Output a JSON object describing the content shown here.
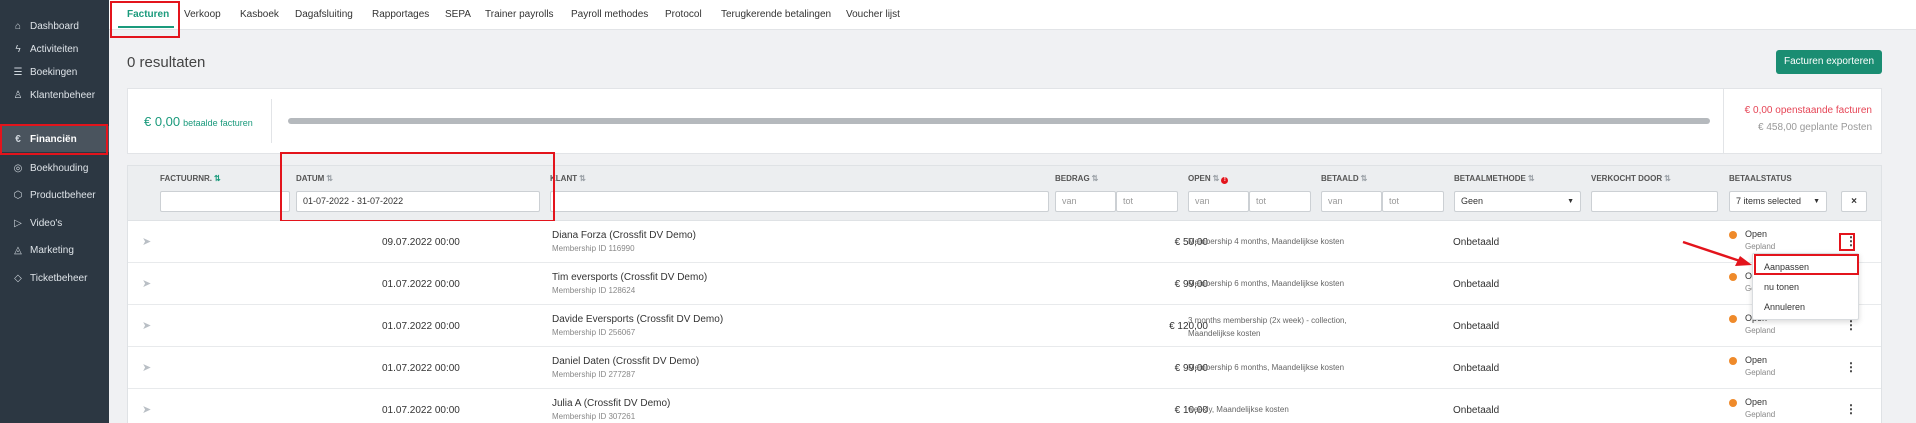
{
  "sidebar": {
    "items": [
      {
        "label": "Dashboard",
        "icon": "home-icon",
        "glyph": "⌂",
        "active": false
      },
      {
        "label": "Activiteiten",
        "icon": "lightning-icon",
        "glyph": "ϟ",
        "active": false
      },
      {
        "label": "Boekingen",
        "icon": "list-icon",
        "glyph": "☰",
        "active": false
      },
      {
        "label": "Klantenbeheer",
        "icon": "user-icon",
        "glyph": "♙",
        "active": false
      },
      {
        "label": "Financiën",
        "icon": "euro-icon",
        "glyph": "€",
        "active": true
      },
      {
        "label": "Boekhouding",
        "icon": "ledger-icon",
        "glyph": "◎",
        "active": false
      },
      {
        "label": "Productbeheer",
        "icon": "box-icon",
        "glyph": "⬡",
        "active": false
      },
      {
        "label": "Video's",
        "icon": "play-icon",
        "glyph": "▷",
        "active": false
      },
      {
        "label": "Marketing",
        "icon": "megaphone-icon",
        "glyph": "◬",
        "active": false
      },
      {
        "label": "Ticketbeheer",
        "icon": "tag-icon",
        "glyph": "◇",
        "active": false
      }
    ]
  },
  "tabs": [
    "Facturen",
    "Verkoop",
    "Kasboek",
    "Dagafsluiting",
    "Rapportages",
    "SEPA",
    "Trainer payrolls",
    "Payroll methodes",
    "Protocol",
    "Terugkerende betalingen",
    "Voucher lijst"
  ],
  "main": {
    "results": "0 resultaten",
    "export_label": "Facturen exporteren"
  },
  "summary": {
    "paid_amount": "€ 0,00",
    "paid_label": "betaalde facturen",
    "paid_progress": 0,
    "open_line": "€ 0,00 openstaande facturen",
    "planned_line": "€ 458,00 geplante Posten"
  },
  "table": {
    "headers": {
      "invoice": "FACTUURNR.",
      "date": "DATUM",
      "client": "KLANT",
      "amount": "BEDRAG",
      "open": "OPEN",
      "paid": "BETAALD",
      "method": "BETAALMETHODE",
      "sold_by": "VERKOCHT DOOR",
      "status": "BETAALSTATUS"
    },
    "filters": {
      "date_value": "01-07-2022 - 31-07-2022",
      "from_placeholder": "van",
      "to_placeholder": "tot",
      "method_value": "Geen",
      "status_value": "7 items selected",
      "clear_label": "×"
    },
    "rows": [
      {
        "date": "09.07.2022 00:00",
        "client": "Diana Forza (Crossfit DV Demo)",
        "membership": "Membership ID 116990",
        "amount": "€ 50,00",
        "desc": "Membership 4 months, Maandelijkse kosten",
        "pay_status": "Onbetaald",
        "status": "Open",
        "sub": "Gepland"
      },
      {
        "date": "01.07.2022 00:00",
        "client": "Tim eversports (Crossfit DV Demo)",
        "membership": "Membership ID 128624",
        "amount": "€ 99,00",
        "desc": "Membership 6 months, Maandelijkse kosten",
        "pay_status": "Onbetaald",
        "status": "Open",
        "sub": "Gepland"
      },
      {
        "date": "01.07.2022 00:00",
        "client": "Davide Eversports (Crossfit DV Demo)",
        "membership": "Membership ID 256067",
        "amount": "€ 120,00",
        "desc": "3 months membership (2x week) - collection, Maandelijkse kosten",
        "pay_status": "Onbetaald",
        "status": "Open",
        "sub": "Gepland"
      },
      {
        "date": "01.07.2022 00:00",
        "client": "Daniel Daten (Crossfit DV Demo)",
        "membership": "Membership ID 277287",
        "amount": "€ 99,00",
        "desc": "Membership 6 months, Maandelijkse kosten",
        "pay_status": "Onbetaald",
        "status": "Open",
        "sub": "Gepland"
      },
      {
        "date": "01.07.2022 00:00",
        "client": "Julia A (Crossfit DV Demo)",
        "membership": "Membership ID 307261",
        "amount": "€ 10,00",
        "desc": "weekly, Maandelijkse kosten",
        "pay_status": "Onbetaald",
        "status": "Open",
        "sub": "Gepland"
      }
    ]
  },
  "dropdown": {
    "items": [
      "Aanpassen",
      "nu tonen",
      "Annuleren"
    ]
  },
  "colors": {
    "accent": "#1a9a7c",
    "highlight": "#e3141c",
    "status_dot": "#ef8a2a",
    "sidebar": "#2c3742"
  }
}
